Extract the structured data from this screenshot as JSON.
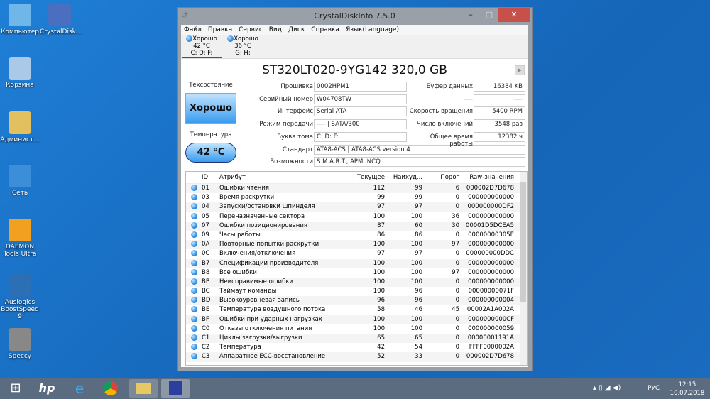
{
  "desktop": [
    "Компьютер",
    "CrystalDisk...",
    "Корзина",
    "Админист...",
    "Сеть",
    "DAEMON Tools Ultra",
    "Auslogics BoostSpeed 9",
    "Speccy"
  ],
  "window": {
    "title": "CrystalDiskInfo 7.5.0",
    "minimize": "–",
    "maximize": "□",
    "close": "✕"
  },
  "menu": [
    "Файл",
    "Правка",
    "Сервис",
    "Вид",
    "Диск",
    "Справка",
    "Язык(Language)"
  ],
  "drives": [
    {
      "status": "Хорошо",
      "temp": "42 °C",
      "letters": "C: D: F:"
    },
    {
      "status": "Хорошо",
      "temp": "36 °C",
      "letters": "G: H:"
    }
  ],
  "model": "ST320LT020-9YG142 320,0 GB",
  "health_label": "Техсостояние",
  "health": "Хорошо",
  "temp_label": "Температура",
  "temp": "42 °C",
  "fields": [
    [
      "Прошивка",
      "0002HPM1"
    ],
    [
      "Серийный номер",
      "W04708TW"
    ],
    [
      "Интерфейс",
      "Serial ATA"
    ],
    [
      "Режим передачи",
      "---- | SATA/300"
    ],
    [
      "Буква тома",
      "C: D: F:"
    ],
    [
      "Стандарт",
      "ATA8-ACS | ATA8-ACS version 4"
    ],
    [
      "Возможности",
      "S.M.A.R.T., APM, NCQ"
    ]
  ],
  "right_fields": [
    [
      "Буфер данных",
      "16384 KB"
    ],
    [
      "----",
      "----"
    ],
    [
      "Скорость вращения",
      "5400 RPM"
    ],
    [
      "Число включений",
      "3548 раз"
    ],
    [
      "Общее время работы",
      "12382 ч"
    ]
  ],
  "columns": [
    "",
    "ID",
    "Атрибут",
    "Текущее",
    "Наихуд...",
    "Порог",
    "Raw-значения"
  ],
  "rows": [
    [
      "01",
      "Ошибки чтения",
      "112",
      "99",
      "6",
      "000002D7D678"
    ],
    [
      "03",
      "Время раскрутки",
      "99",
      "99",
      "0",
      "000000000000"
    ],
    [
      "04",
      "Запуски/остановки шпинделя",
      "97",
      "97",
      "0",
      "000000000DF2"
    ],
    [
      "05",
      "Переназначенные сектора",
      "100",
      "100",
      "36",
      "000000000000"
    ],
    [
      "07",
      "Ошибки позиционирования",
      "87",
      "60",
      "30",
      "00001D5DCEA5"
    ],
    [
      "09",
      "Часы работы",
      "86",
      "86",
      "0",
      "00000000305E"
    ],
    [
      "0A",
      "Повторные попытки раскрутки",
      "100",
      "100",
      "97",
      "000000000000"
    ],
    [
      "0C",
      "Включения/отключения",
      "97",
      "97",
      "0",
      "000000000DDC"
    ],
    [
      "B7",
      "Спецификации производителя",
      "100",
      "100",
      "0",
      "000000000000"
    ],
    [
      "B8",
      "Все ошибки",
      "100",
      "100",
      "97",
      "000000000000"
    ],
    [
      "BB",
      "Неисправимые ошибки",
      "100",
      "100",
      "0",
      "000000000000"
    ],
    [
      "BC",
      "Таймаут команды",
      "100",
      "96",
      "0",
      "00000000071F"
    ],
    [
      "BD",
      "Высокоуровневая запись",
      "96",
      "96",
      "0",
      "000000000004"
    ],
    [
      "BE",
      "Температура воздушного потока",
      "58",
      "46",
      "45",
      "00002A1A002A"
    ],
    [
      "BF",
      "Ошибки при ударных нагрузках",
      "100",
      "100",
      "0",
      "0000000000CF"
    ],
    [
      "C0",
      "Отказы отключения питания",
      "100",
      "100",
      "0",
      "000000000059"
    ],
    [
      "C1",
      "Циклы загрузки/выгрузки",
      "65",
      "65",
      "0",
      "00000001191A"
    ],
    [
      "C2",
      "Температура",
      "42",
      "54",
      "0",
      "FFFF0000002A"
    ],
    [
      "C3",
      "Аппаратное ECC-восстановление",
      "52",
      "33",
      "0",
      "000002D7D678"
    ]
  ],
  "tray": {
    "lang": "РУС",
    "time": "12:15",
    "date": "10.07.2018"
  }
}
